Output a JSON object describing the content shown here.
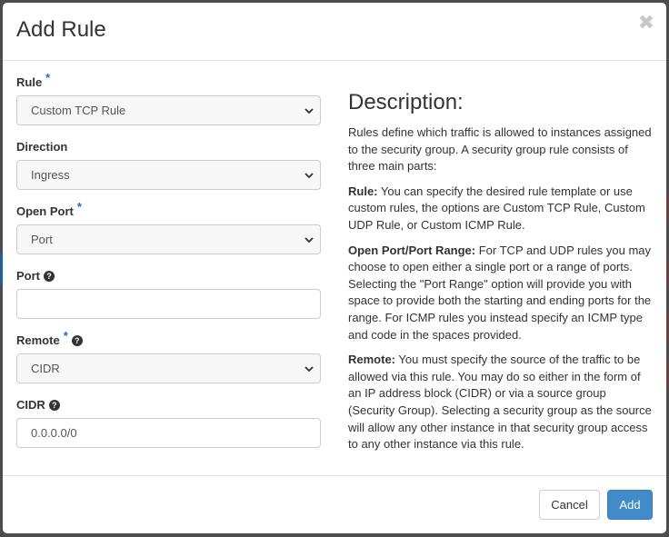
{
  "modal": {
    "title": "Add Rule",
    "close_glyph": "✖"
  },
  "form": {
    "rule": {
      "label": "Rule",
      "required_mark": "*",
      "value": "Custom TCP Rule"
    },
    "direction": {
      "label": "Direction",
      "value": "Ingress"
    },
    "open_port": {
      "label": "Open Port",
      "required_mark": "*",
      "value": "Port"
    },
    "port": {
      "label": "Port",
      "value": ""
    },
    "remote": {
      "label": "Remote",
      "required_mark": "*",
      "value": "CIDR"
    },
    "cidr": {
      "label": "CIDR",
      "value": "0.0.0.0/0"
    },
    "help_glyph": "?"
  },
  "description": {
    "title": "Description:",
    "intro": "Rules define which traffic is allowed to instances assigned to the security group. A security group rule consists of three main parts:",
    "rule_term": "Rule:",
    "rule_text": " You can specify the desired rule template or use custom rules, the options are Custom TCP Rule, Custom UDP Rule, or Custom ICMP Rule.",
    "port_term": "Open Port/Port Range:",
    "port_text": " For TCP and UDP rules you may choose to open either a single port or a range of ports. Selecting the \"Port Range\" option will provide you with space to provide both the starting and ending ports for the range. For ICMP rules you instead specify an ICMP type and code in the spaces provided.",
    "remote_term": "Remote:",
    "remote_text": " You must specify the source of the traffic to be allowed via this rule. You may do so either in the form of an IP address block (CIDR) or via a source group (Security Group). Selecting a security group as the source will allow any other instance in that security group access to any other instance via this rule."
  },
  "footer": {
    "cancel_label": "Cancel",
    "add_label": "Add"
  },
  "colors": {
    "primary": "#428bca",
    "required": "#2a6ebb",
    "backdrop": "#4d4d4d"
  }
}
